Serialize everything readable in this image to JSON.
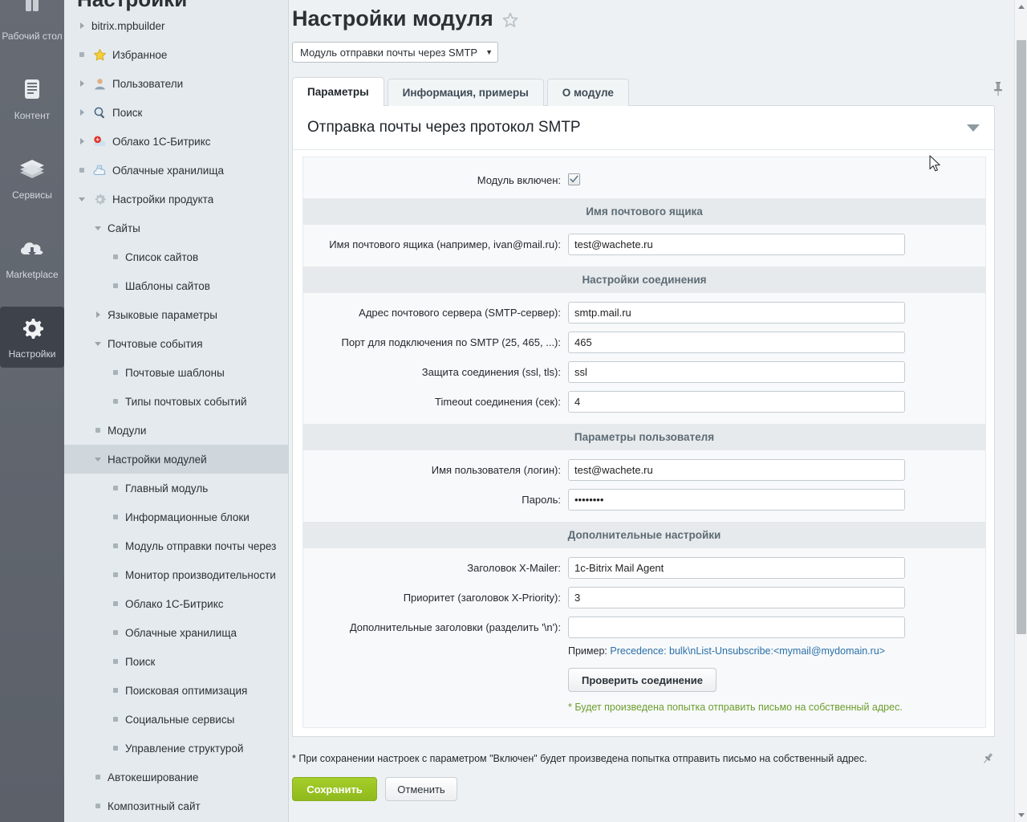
{
  "rail": {
    "items": [
      {
        "label": "Рабочий стол",
        "icon": "desktop-icon",
        "active": false
      },
      {
        "label": "Контент",
        "icon": "content-document-icon",
        "active": false
      },
      {
        "label": "Сервисы",
        "icon": "layers-services-icon",
        "active": false
      },
      {
        "label": "Marketplace",
        "icon": "cloud-download-icon",
        "active": false
      },
      {
        "label": "Настройки",
        "icon": "gear-settings-icon",
        "active": true
      }
    ]
  },
  "sidebar": {
    "title": "Настройки",
    "items": [
      {
        "label": "bitrix.mpbuilder",
        "level": 1,
        "toggle": "arrow-r",
        "icon": "",
        "selected": false
      },
      {
        "label": "Избранное",
        "level": 1,
        "toggle": "dot",
        "icon": "star-icon",
        "selected": false
      },
      {
        "label": "Пользователи",
        "level": 1,
        "toggle": "arrow-r",
        "icon": "user-icon",
        "selected": false
      },
      {
        "label": "Поиск",
        "level": 1,
        "toggle": "arrow-r",
        "icon": "magnifier-icon",
        "selected": false
      },
      {
        "label": "Облако 1С-Битрикс",
        "level": 1,
        "toggle": "arrow-r",
        "icon": "cloud-bitrix-icon",
        "selected": false
      },
      {
        "label": "Облачные хранилища",
        "level": 1,
        "toggle": "dot",
        "icon": "cloud-storage-icon",
        "selected": false
      },
      {
        "label": "Настройки продукта",
        "level": 1,
        "toggle": "arrow-d",
        "icon": "gear-small-icon",
        "selected": false
      },
      {
        "label": "Сайты",
        "level": 2,
        "toggle": "arrow-d",
        "icon": "",
        "selected": false
      },
      {
        "label": "Список сайтов",
        "level": 3,
        "toggle": "dot",
        "icon": "",
        "selected": false
      },
      {
        "label": "Шаблоны сайтов",
        "level": 3,
        "toggle": "dot",
        "icon": "",
        "selected": false
      },
      {
        "label": "Языковые параметры",
        "level": 2,
        "toggle": "arrow-r",
        "icon": "",
        "selected": false
      },
      {
        "label": "Почтовые события",
        "level": 2,
        "toggle": "arrow-d",
        "icon": "",
        "selected": false
      },
      {
        "label": "Почтовые шаблоны",
        "level": 3,
        "toggle": "dot",
        "icon": "",
        "selected": false
      },
      {
        "label": "Типы почтовых событий",
        "level": 3,
        "toggle": "dot",
        "icon": "",
        "selected": false
      },
      {
        "label": "Модули",
        "level": 2,
        "toggle": "dot",
        "icon": "",
        "selected": false
      },
      {
        "label": "Настройки модулей",
        "level": 2,
        "toggle": "arrow-d",
        "icon": "",
        "selected": true
      },
      {
        "label": "Главный модуль",
        "level": 3,
        "toggle": "dot",
        "icon": "",
        "selected": false
      },
      {
        "label": "Информационные блоки",
        "level": 3,
        "toggle": "dot",
        "icon": "",
        "selected": false
      },
      {
        "label": "Модуль отправки почты через",
        "level": 3,
        "toggle": "dot",
        "icon": "",
        "selected": false
      },
      {
        "label": "Монитор производительности",
        "level": 3,
        "toggle": "dot",
        "icon": "",
        "selected": false
      },
      {
        "label": "Облако 1С-Битрикс",
        "level": 3,
        "toggle": "dot",
        "icon": "",
        "selected": false
      },
      {
        "label": "Облачные хранилища",
        "level": 3,
        "toggle": "dot",
        "icon": "",
        "selected": false
      },
      {
        "label": "Поиск",
        "level": 3,
        "toggle": "dot",
        "icon": "",
        "selected": false
      },
      {
        "label": "Поисковая оптимизация",
        "level": 3,
        "toggle": "dot",
        "icon": "",
        "selected": false
      },
      {
        "label": "Социальные сервисы",
        "level": 3,
        "toggle": "dot",
        "icon": "",
        "selected": false
      },
      {
        "label": "Управление структурой",
        "level": 3,
        "toggle": "dot",
        "icon": "",
        "selected": false
      },
      {
        "label": "Автокеширование",
        "level": 2,
        "toggle": "dot",
        "icon": "",
        "selected": false
      },
      {
        "label": "Композитный сайт",
        "level": 2,
        "toggle": "dot",
        "icon": "",
        "selected": false
      }
    ]
  },
  "header": {
    "title": "Настройки модуля",
    "module_select_value": "Модуль отправки почты через SMTP",
    "caret": "▼"
  },
  "tabs": [
    {
      "label": "Параметры",
      "active": true
    },
    {
      "label": "Информация, примеры",
      "active": false
    },
    {
      "label": "О модуле",
      "active": false
    }
  ],
  "panel": {
    "heading": "Отправка почты через протокол SMTP",
    "enabled_label": "Модуль включен:",
    "enabled_checked": true,
    "sections": [
      {
        "band": "Имя почтового ящика",
        "fields": [
          {
            "label": "Имя почтового ящика (например, ivan@mail.ru):",
            "value": "test@wachete.ru",
            "type": "text",
            "name": "mailbox-name-input"
          }
        ]
      },
      {
        "band": "Настройки соединения",
        "fields": [
          {
            "label": "Адрес почтового сервера (SMTP-сервер):",
            "value": "smtp.mail.ru",
            "type": "text",
            "name": "smtp-server-input"
          },
          {
            "label": "Порт для подключения по SMTP (25, 465, ...):",
            "value": "465",
            "type": "text",
            "name": "smtp-port-input"
          },
          {
            "label": "Защита соединения (ssl, tls):",
            "value": "ssl",
            "type": "text",
            "name": "smtp-security-input"
          },
          {
            "label": "Timeout соединения (сек):",
            "value": "4",
            "type": "text",
            "name": "smtp-timeout-input"
          }
        ]
      },
      {
        "band": "Параметры пользователя",
        "fields": [
          {
            "label": "Имя пользователя (логин):",
            "value": "test@wachete.ru",
            "type": "text",
            "name": "smtp-login-input"
          },
          {
            "label": "Пароль:",
            "value": "••••••••",
            "type": "password",
            "name": "smtp-password-input"
          }
        ]
      },
      {
        "band": "Дополнительные настройки",
        "fields": [
          {
            "label": "Заголовок X-Mailer:",
            "value": "1c-Bitrix Mail Agent",
            "type": "text",
            "name": "x-mailer-input"
          },
          {
            "label": "Приоритет (заголовок X-Priority):",
            "value": "3",
            "type": "text",
            "name": "x-priority-input"
          },
          {
            "label": "Дополнительные заголовки (разделить '\\n'):",
            "value": "",
            "type": "text",
            "name": "extra-headers-input"
          }
        ]
      }
    ],
    "example_prefix": "Пример:",
    "example_link": "Precedence: bulk\\nList-Unsubscribe:<mymail@mydomain.ru>",
    "check_button": "Проверить соединение",
    "check_note": "* Будет произведена попытка отправить письмо на собственный адрес."
  },
  "footer": {
    "note": "* При сохранении настроек с параметром \"Включен\" будет произведена попытка отправить письмо на собственный адрес.",
    "save_label": "Сохранить",
    "cancel_label": "Отменить"
  },
  "colors": {
    "rail_bg": "#5f646d",
    "rail_active": "#3e434b",
    "sidebar_bg": "#e4eaee",
    "sidebar_selected": "#cfd7dc",
    "band_bg": "#e6eaec",
    "band_text": "#5d6b75",
    "link": "#2a6fa8",
    "note_green": "#6d9e2f",
    "save_green": "#a5ce2a"
  }
}
